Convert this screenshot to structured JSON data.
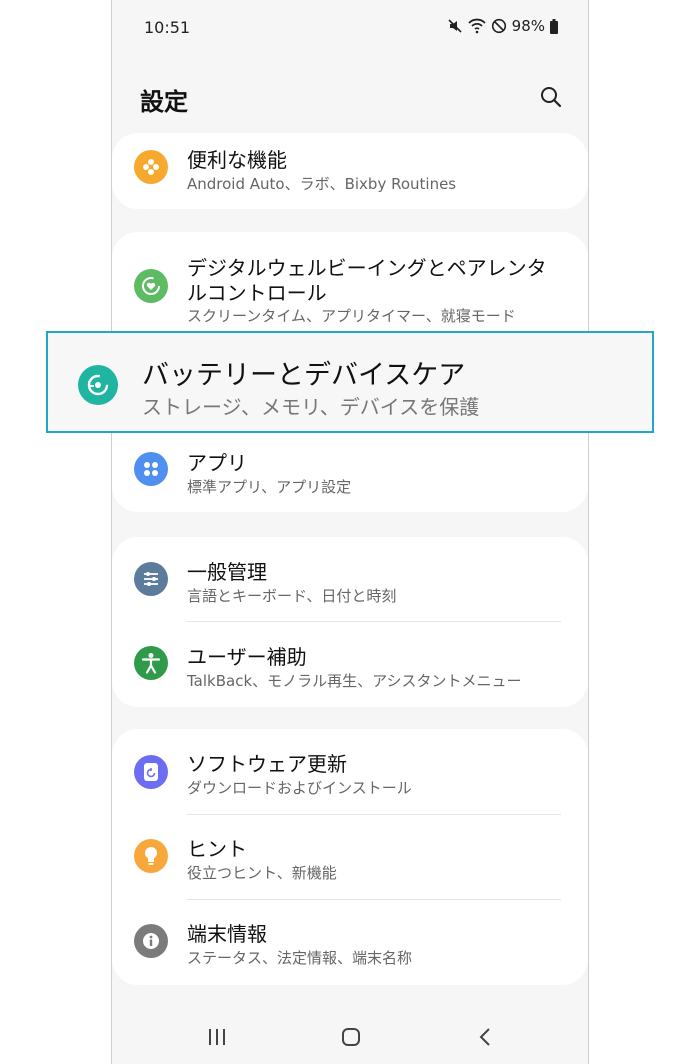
{
  "status_bar": {
    "time": "10:51",
    "battery": "98%"
  },
  "header": {
    "title": "設定"
  },
  "items": {
    "advanced": {
      "label": "便利な機能",
      "sub": "Android Auto、ラボ、Bixby Routines"
    },
    "wellbeing": {
      "label_line1": "デジタルウェルビーイングとペアレンタ",
      "label_line2": "ルコントロール",
      "sub": "スクリーンタイム、アプリタイマー、就寝モード"
    },
    "battery": {
      "label": "バッテリーとデバイスケア",
      "sub": "ストレージ、メモリ、デバイスを保護"
    },
    "apps": {
      "label": "アプリ",
      "sub": "標準アプリ、アプリ設定"
    },
    "general": {
      "label": "一般管理",
      "sub": "言語とキーボード、日付と時刻"
    },
    "accessibility": {
      "label": "ユーザー補助",
      "sub": "TalkBack、モノラル再生、アシスタントメニュー"
    },
    "software": {
      "label": "ソフトウェア更新",
      "sub": "ダウンロードおよびインストール"
    },
    "tips": {
      "label": "ヒント",
      "sub": "役立つヒント、新機能"
    },
    "about": {
      "label": "端末情報",
      "sub": "ステータス、法定情報、端末名称"
    }
  },
  "colors": {
    "advanced": "#f6a92c",
    "wellbeing": "#5cbb63",
    "battery": "#1fb5a0",
    "apps": "#4f8ff0",
    "general": "#5d7b9a",
    "accessibility": "#2f9a4a",
    "software": "#6d6df2",
    "tips": "#f8a83a",
    "about": "#7b7b7b",
    "highlight_border": "#22a7c9"
  }
}
